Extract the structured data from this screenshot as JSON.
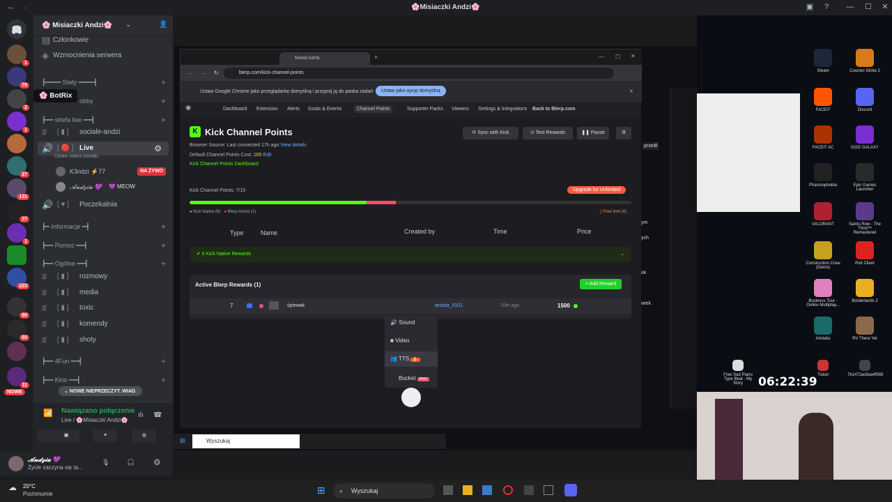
{
  "discord": {
    "title": "🌸Misiaczki Andzi🌸",
    "server_name": "🌸 Misiaczki Andzi🌸",
    "tooltip": "BotRix",
    "top_items": [
      "Członkowie",
      "Wzmocnienia serwera"
    ],
    "badges": [
      "1",
      "76",
      "2",
      "1",
      "27",
      "131",
      "37",
      "1",
      "223",
      "80",
      "60",
      "11"
    ],
    "now_badge": "NOWE",
    "channels": [
      {
        "type": "cat",
        "label": "┣━━━━ Staty ━━━━┫"
      },
      {
        "type": "cat",
        "label": "obby"
      },
      {
        "type": "cat",
        "label": "┣━━ strefa live ━━┫"
      },
      {
        "type": "text",
        "label": "sociale-andzi"
      },
      {
        "type": "voice",
        "label": "Live"
      },
      {
        "type": "voice",
        "label": "Poczekalnia"
      },
      {
        "type": "cat",
        "label": "┣━ Informacje ━┫"
      },
      {
        "type": "cat",
        "label": "┣━━ Pomoc ━━┫"
      },
      {
        "type": "cat",
        "label": "┣━━ Ogólne ━━┫"
      },
      {
        "type": "text",
        "label": "rozmowy"
      },
      {
        "type": "text",
        "label": "media"
      },
      {
        "type": "text",
        "label": "toxic"
      },
      {
        "type": "text",
        "label": "komendy"
      },
      {
        "type": "text",
        "label": "shoty"
      },
      {
        "type": "cat",
        "label": "┣━━ 4Fun ━━┫"
      },
      {
        "type": "cat",
        "label": "┣━━ Kino ━━┫"
      }
    ],
    "live_status": "Ustaw status kanału",
    "live_users": [
      {
        "name": "K3ndzi ⚡77",
        "tag": "NA ŻYWO"
      },
      {
        "name": "𝓐𝓷𝓭𝔃𝓲𝓪 💜",
        "tag": "💜 MEOW"
      }
    ],
    "unread_pill": "NOWE NIEPRZECZYT. WIAD.",
    "connection": {
      "status": "Nawiązano połączenie",
      "where": "Live / 🌸Misiaczki Andzi🌸"
    },
    "user": {
      "name": "𝓐𝓷𝓭𝔃𝓲𝓪 💜",
      "status": "Życie zaczyna się ta..."
    }
  },
  "weather": {
    "temp": "20°C",
    "desc": "Pochmurnie"
  },
  "taskbar": {
    "search": "Wyszukaj"
  },
  "chrome": {
    "tab_title": "Nowa karta",
    "url": "blerp.com/kick-channel-points",
    "banner": "Ustaw Google Chrome jako przeglądarkę domyślną i przypnij ją do paska zadań",
    "banner_button": "Ustaw jako opcję domyślną"
  },
  "blerp": {
    "nav": [
      "Dashboard",
      "Extension",
      "Alerts",
      "Goals & Events",
      "Channel Points",
      "Supporter Packs",
      "Viewers",
      "Settings & Integrations",
      "Back to Blerp.com"
    ],
    "title": "Kick Channel Points",
    "source": "Browser Source: Last connected 17h ago",
    "view_details": "View details",
    "cost_label": "Default Channel Points Cost:",
    "cost_value": "100",
    "edit": "Edit",
    "dashboard_link": "Kick Channel Points Dashboard",
    "sync": "Sync with Kick",
    "test": "Test Rewards",
    "pause": "Pause",
    "points_label": "Kick Channel Points: 7/15",
    "upgrade": "Upgrade for Unlimited",
    "legend_native": "Kick Native (6)",
    "legend_blerp": "Blerp Active (1)",
    "free_limit": "[ Free limit (4)",
    "progress_native": 0.4,
    "progress_blerp": 0.067,
    "columns": [
      "Type",
      "Name",
      "Created by",
      "Time",
      "Price"
    ],
    "native_rewards": "6 Kick Native Rewards",
    "active_rewards": "Active Blerp Rewards (1)",
    "add_reward": "+ Add Reward",
    "reward": {
      "num": "7",
      "name": "śpiewak",
      "creator": "andzia_0101",
      "time": "10m ago",
      "price": "1500"
    },
    "menu": [
      "Sound",
      "Video",
      "TTS",
      "Bucket"
    ],
    "pro": "PRO"
  },
  "desktop": {
    "icons": [
      "Steam",
      "Counter-Strike 2",
      "FACEIT",
      "Discord",
      "FACEIT AC",
      "GOG GALAXY",
      "Phasmophobia",
      "Epic Games Launcher",
      "VALORANT",
      "Saints Row - The Third™ Remastered",
      "Construction Crew (Demo)",
      "Riot Client",
      "Business Tour - Online Multiplay...",
      "Borderlands 2",
      "Aimlabs",
      "RV There Yet",
      "Free Sad Piano Type Beat - My Story",
      "Ticket",
      "7b1472ac6ea4f569"
    ],
    "clock": "06:22:39"
  },
  "stream": {
    "side_labels": [
      "przedł",
      "ym",
      "ych",
      "ok",
      "wiek"
    ]
  }
}
